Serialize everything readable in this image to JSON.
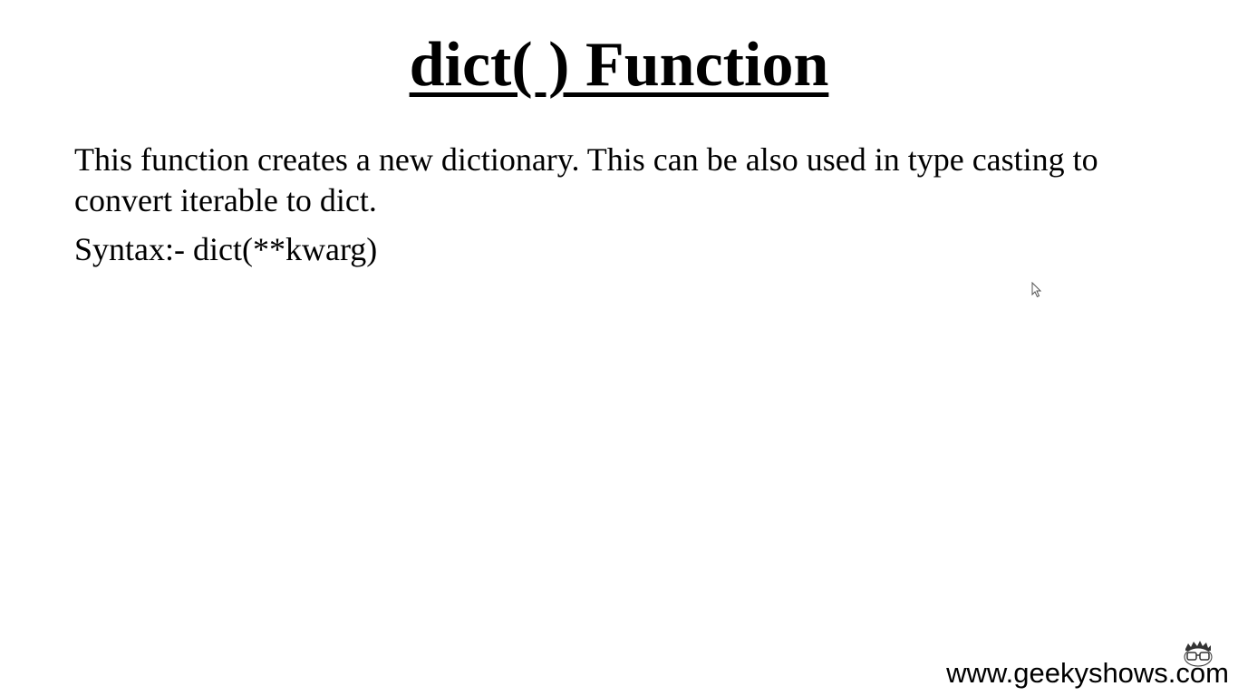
{
  "slide": {
    "title": "dict( ) Function",
    "description": "This function creates a new dictionary. This can be also used in type casting to convert iterable to dict.",
    "syntax": "Syntax:- dict(**kwarg)"
  },
  "footer": {
    "website": "www.geekyshows.com",
    "logo_icon": "geeky-face-logo-icon"
  },
  "colors": {
    "background": "#ffffff",
    "text": "#000000"
  }
}
